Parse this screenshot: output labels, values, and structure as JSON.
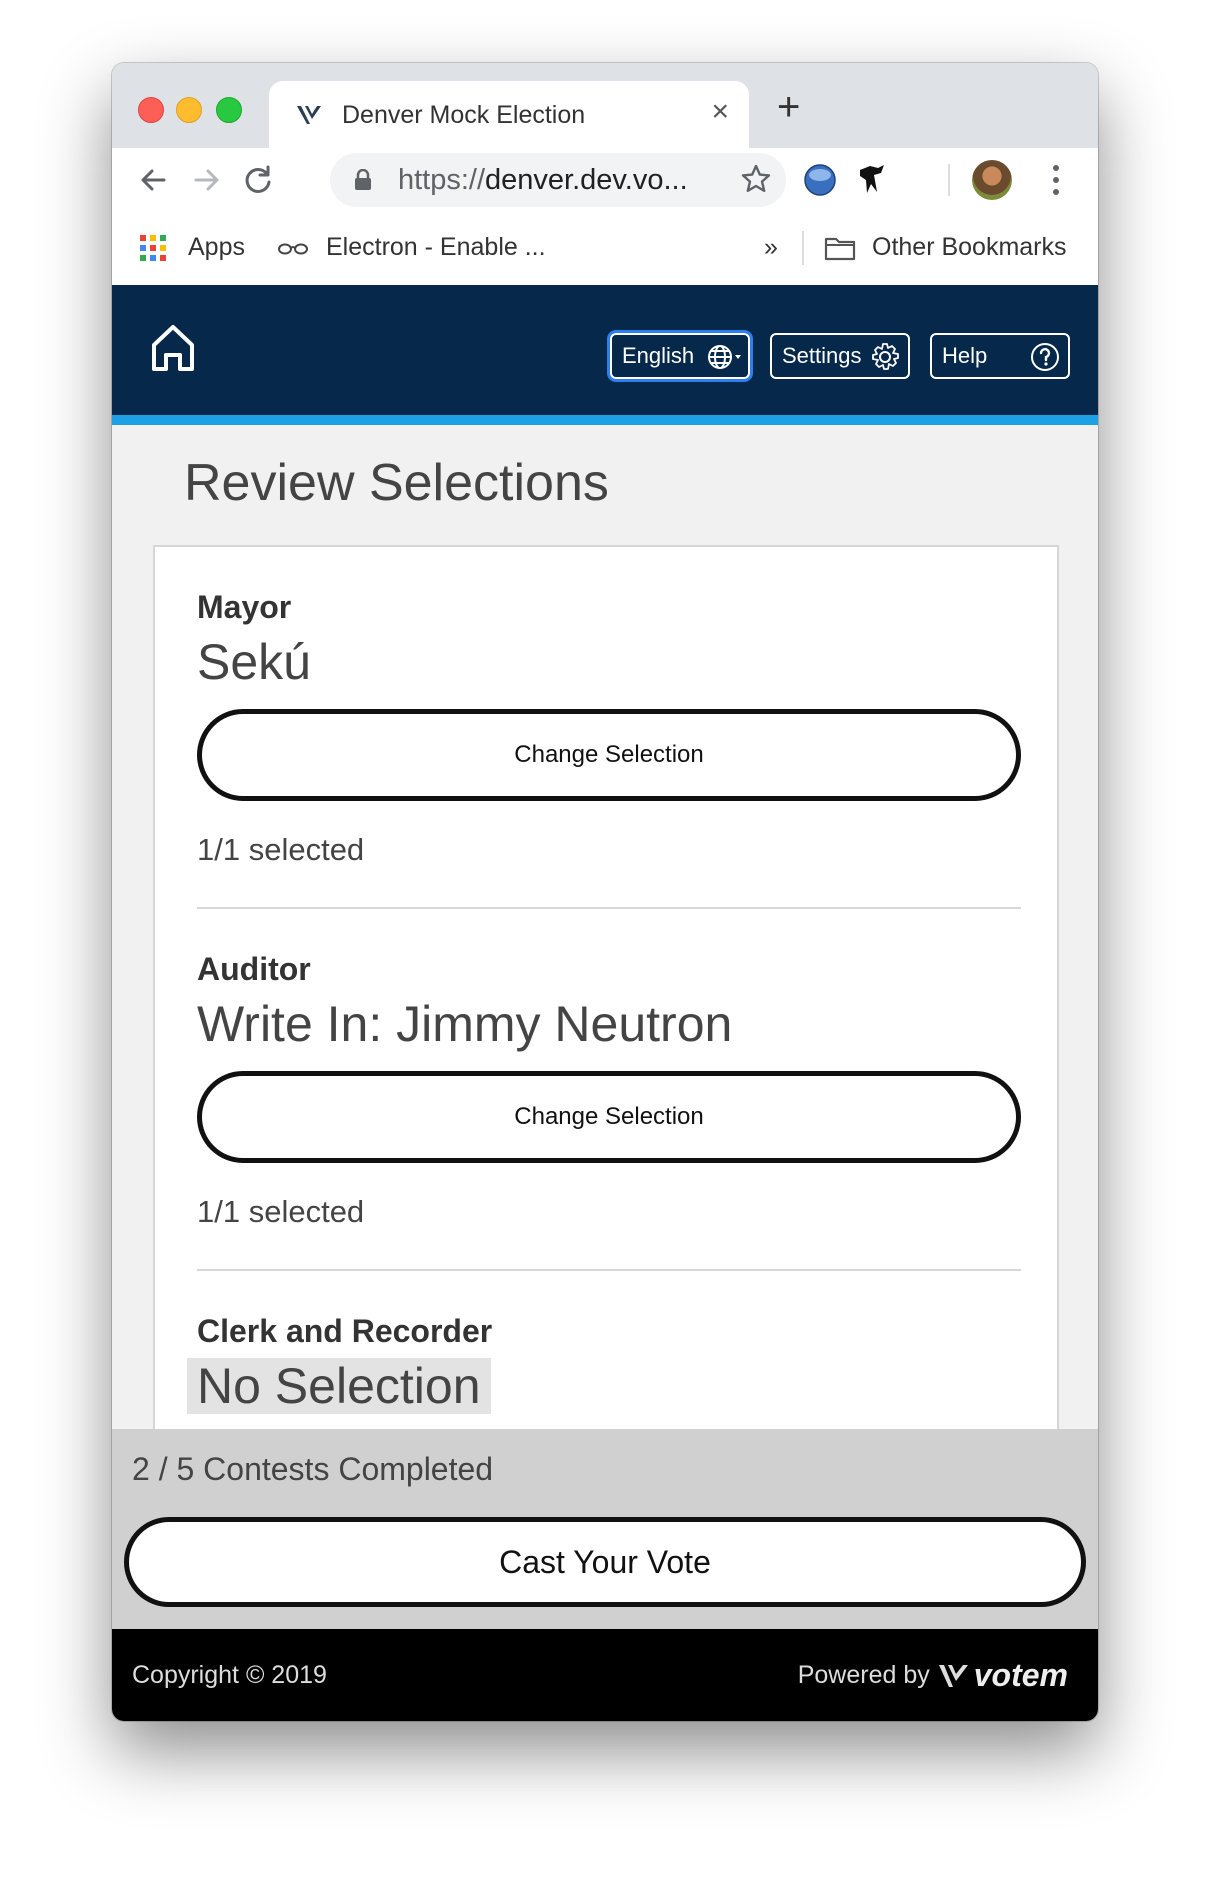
{
  "browser": {
    "tab_title": "Denver Mock Election",
    "close_symbol": "×",
    "new_tab_symbol": "+",
    "url_scheme": "https://",
    "url_host": "denver.dev.vo...",
    "bookmarks": {
      "apps": "Apps",
      "electron": "Electron - Enable ...",
      "overflow": "»",
      "other": "Other Bookmarks"
    }
  },
  "app_header": {
    "language_label": "English",
    "settings_label": "Settings",
    "help_label": "Help"
  },
  "page": {
    "title": "Review Selections",
    "contests": [
      {
        "name": "Mayor",
        "choice": "Sekú",
        "button": "Change Selection",
        "count": "1/1 selected"
      },
      {
        "name": "Auditor",
        "choice": "Write In: Jimmy Neutron",
        "button": "Change Selection",
        "count": "1/1 selected"
      },
      {
        "name": "Clerk and Recorder",
        "choice": "No Selection"
      }
    ]
  },
  "status": {
    "progress_text": "2 / 5 Contests Completed",
    "cast_button": "Cast Your Vote"
  },
  "footer": {
    "copyright": "Copyright © 2019",
    "powered_by": "Powered by",
    "brand": "votem"
  },
  "colors": {
    "header_bg": "#06284a",
    "accent_bar": "#1ea0e6",
    "focus_ring": "#2d7ff0"
  }
}
